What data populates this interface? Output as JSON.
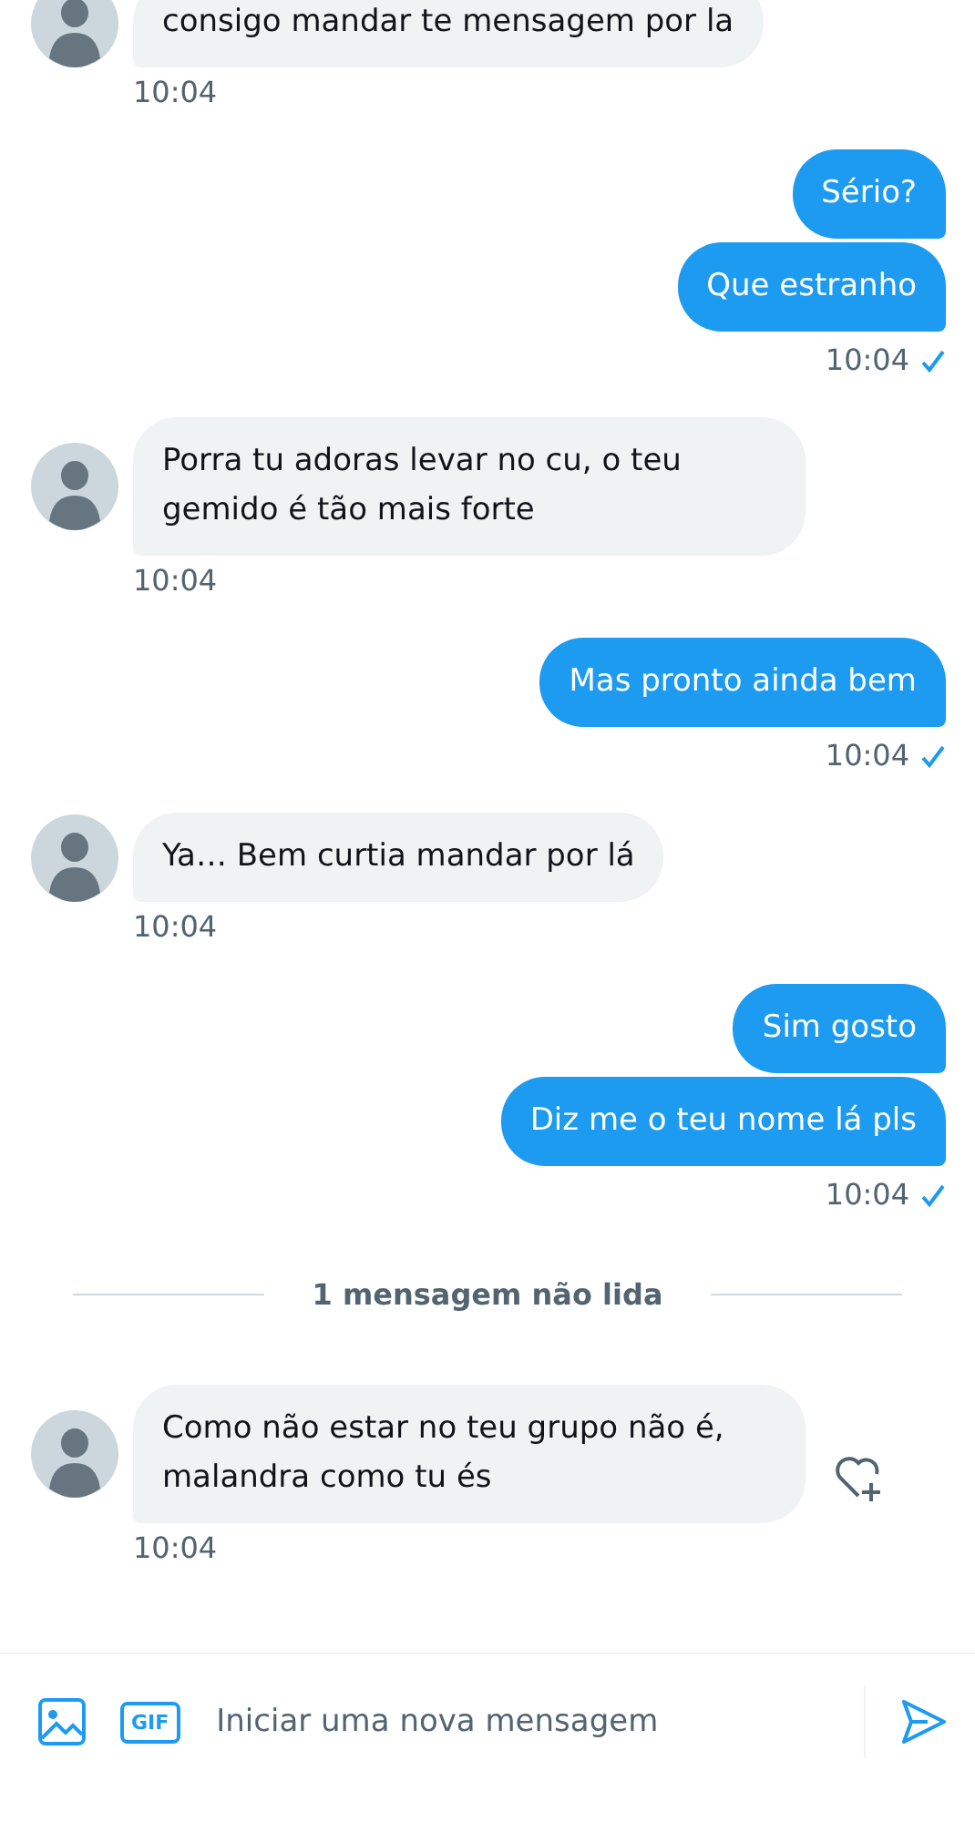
{
  "conversation": [
    {
      "kind": "received",
      "messages": [
        "consigo mandar te mensagem por la"
      ],
      "time": "10:04",
      "reaction_button": false
    },
    {
      "kind": "sent",
      "messages": [
        "Sério?",
        "Que estranho"
      ],
      "time": "10:04",
      "read": true
    },
    {
      "kind": "received",
      "messages": [
        "Porra tu adoras levar no cu, o teu gemido é tão mais forte"
      ],
      "time": "10:04",
      "reaction_button": false
    },
    {
      "kind": "sent",
      "messages": [
        "Mas pronto ainda bem"
      ],
      "time": "10:04",
      "read": true
    },
    {
      "kind": "received",
      "messages": [
        "Ya… Bem curtia mandar por lá"
      ],
      "time": "10:04",
      "reaction_button": false
    },
    {
      "kind": "sent",
      "messages": [
        "Sim gosto",
        "Diz me o teu nome lá pls"
      ],
      "time": "10:04",
      "read": true
    },
    {
      "kind": "divider",
      "text": "1 mensagem não lida"
    },
    {
      "kind": "received",
      "messages": [
        "Como não estar no teu grupo não é, malandra como tu és"
      ],
      "time": "10:04",
      "reaction_button": true
    }
  ],
  "composer": {
    "gif_label": "GIF",
    "placeholder": "Iniciar uma nova mensagem"
  }
}
